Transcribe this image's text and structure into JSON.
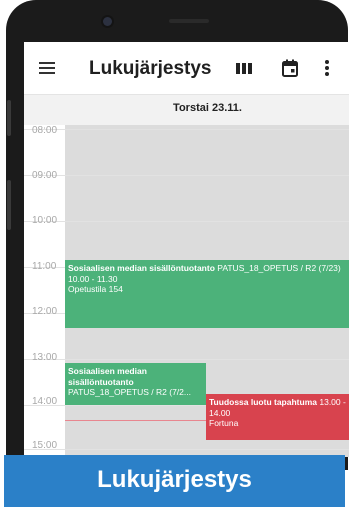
{
  "app": {
    "title": "Lukujärjestys",
    "icons": {
      "menu": "hamburger-menu-icon",
      "week_view": "week-view-icon",
      "calendar": "calendar-icon",
      "more": "more-vertical-icon"
    }
  },
  "day": {
    "date": "Torstai 23.11.",
    "hours": [
      "08:00",
      "09:00",
      "10:00",
      "11:00",
      "12:00",
      "13:00",
      "14:00",
      "15:00"
    ]
  },
  "events": [
    {
      "title": "Sosiaalisen median sisällöntuotanto",
      "group": "PATUS_18_OPETUS / R2 (7/23)",
      "time": "10.00 - 11.30",
      "place": "Opetustila 154",
      "color": "#4cb27a"
    },
    {
      "title": "Sosiaalisen median sisällöntuotanto",
      "group": "PATUS_18_OPETUS / R2 (7/2..."
    },
    {
      "title": "Tuudossa luotu tapahtuma",
      "time": "13.00 - 14.00",
      "place": "Fortuna",
      "color": "#d8434e"
    }
  ],
  "banner": {
    "text": "Lukujärjestys",
    "color": "#2b80c8"
  }
}
